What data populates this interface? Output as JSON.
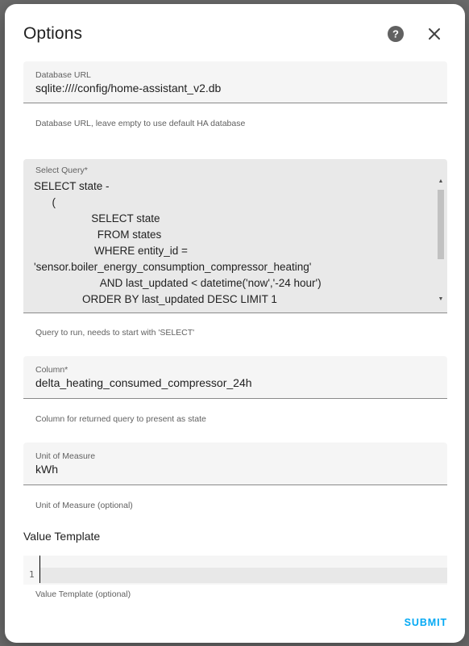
{
  "dialog": {
    "title": "Options",
    "submit_label": "SUBMIT"
  },
  "database_url": {
    "label": "Database URL",
    "value": "sqlite:////config/home-assistant_v2.db",
    "helper": "Database URL, leave empty to use default HA database"
  },
  "query": {
    "label": "Select Query*",
    "value": "SELECT state -\n      (\n                   SELECT state\n                     FROM states\n                    WHERE entity_id =\n'sensor.boiler_energy_consumption_compressor_heating'\n                      AND last_updated < datetime('now','-24 hour')\n                ORDER BY last_updated DESC LIMIT 1",
    "helper": "Query to run, needs to start with 'SELECT'"
  },
  "column": {
    "label": "Column*",
    "value": "delta_heating_consumed_compressor_24h",
    "helper": "Column for returned query to present as state"
  },
  "unit": {
    "label": "Unit of Measure",
    "value": "kWh",
    "helper": "Unit of Measure (optional)"
  },
  "value_template": {
    "title": "Value Template",
    "line_number": "1",
    "helper": "Value Template (optional)"
  },
  "icons": {
    "help": "help-circle-icon",
    "close": "close-icon"
  },
  "colors": {
    "accent": "#03a9f4",
    "overlay": "#6b6b6b",
    "field_bg": "#f5f5f5"
  }
}
